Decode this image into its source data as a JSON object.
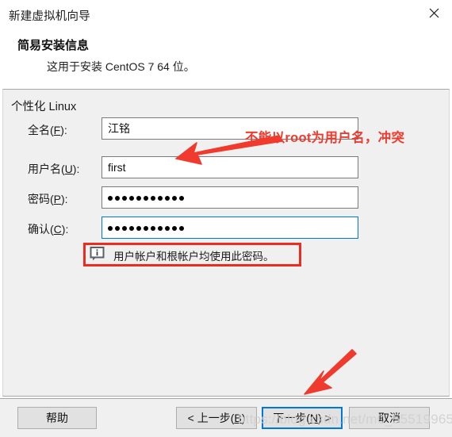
{
  "window": {
    "title": "新建虚拟机向导",
    "close_icon": "close-icon"
  },
  "header": {
    "title": "简易安装信息",
    "subtitle": "这用于安装 CentOS 7 64 位。"
  },
  "panel": {
    "section_title": "个性化 Linux",
    "fields": [
      {
        "label_prefix": "全名(",
        "accel": "F",
        "label_suffix": "):",
        "value": "江铭",
        "type": "text",
        "focused": false,
        "name": "full-name"
      },
      {
        "label_prefix": "用户名(",
        "accel": "U",
        "label_suffix": "):",
        "value": "first",
        "type": "text",
        "focused": false,
        "name": "user-name"
      },
      {
        "label_prefix": "密码(",
        "accel": "P",
        "label_suffix": "):",
        "value": "",
        "masked_length": 11,
        "type": "password",
        "focused": false,
        "name": "password"
      },
      {
        "label_prefix": "确认(",
        "accel": "C",
        "label_suffix": "):",
        "value": "",
        "masked_length": 11,
        "type": "password",
        "focused": true,
        "name": "confirm-password"
      }
    ],
    "note": {
      "icon": "info-bubble-icon",
      "text": "用户帐户和根帐户均使用此密码。",
      "highlight_color": "#ee2b20"
    }
  },
  "annotations": {
    "username_note": "不能以root为用户名，冲突",
    "color": "#ef3a2d"
  },
  "footer": {
    "help_label": "帮助",
    "back_label_prefix": "< 上一步(",
    "back_accel": "B",
    "back_label_suffix": "):",
    "back_label": "< 上一步(B)",
    "next_label_prefix": "下一步(",
    "next_accel": "N",
    "next_label_suffix": ") >",
    "cancel_label": "取消"
  },
  "watermark": {
    "text": "https://blog.csdn.net/m0_55519965"
  }
}
